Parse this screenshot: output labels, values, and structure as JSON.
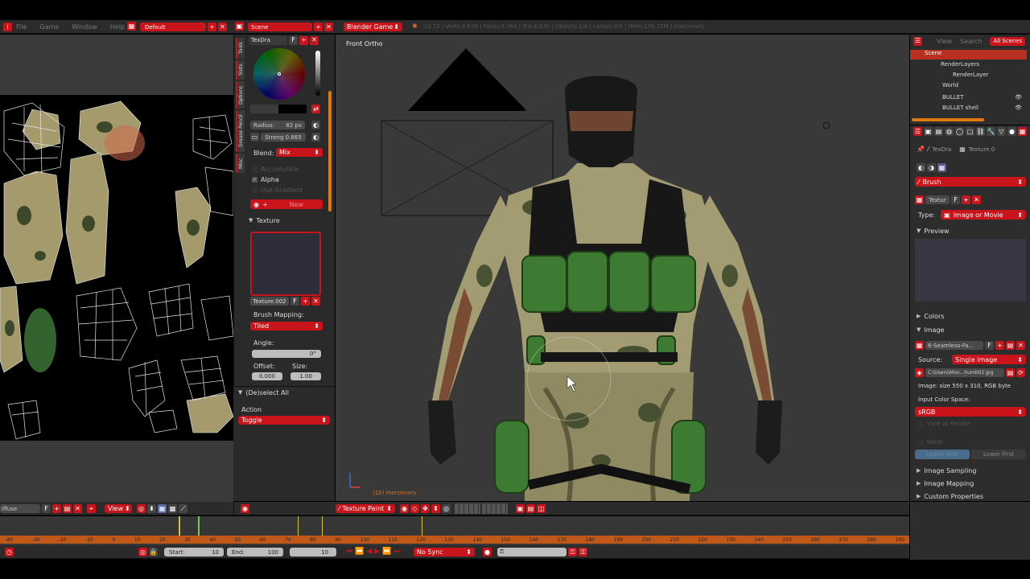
{
  "top": {
    "menus": [
      "File",
      "Game",
      "Window",
      "Help"
    ],
    "layout": "Default",
    "scene": "Scene",
    "engine": "Blender Game",
    "stats": "v2.73 | Verts:3,639 | Faces:3,364 | Tris:6,670 | Objects:1/4 | Lamps:0/2 | Mem:178.25M | mercenary"
  },
  "tool_panel": {
    "tab_name": "TexDra",
    "f_label": "F",
    "vtabs": [
      "Tools",
      "Slots",
      "Options",
      "Grease Pencil",
      "Misc"
    ],
    "radius_label": "Radius:",
    "radius_value": "82 px",
    "strength_label": "Streng",
    "strength_value": "0.665",
    "blend_label": "Blend:",
    "blend_value": "Mix",
    "accumulate": "Accumulate",
    "alpha": "Alpha",
    "use_gradient": "Use Gradient",
    "new_label": "New",
    "texture_header": "Texture",
    "texture_name": "Texture.002",
    "brush_mapping_label": "Brush Mapping:",
    "brush_mapping_value": "Tiled",
    "angle_label": "Angle:",
    "angle_value": "0°",
    "offset_label": "Offset:",
    "size_label": "Size:",
    "offset_value": "0.000",
    "size_value": "1.00"
  },
  "operator": {
    "title": "(De)select All",
    "action_label": "Action",
    "action_value": "Toggle"
  },
  "viewport": {
    "view_name": "Front Ortho",
    "object_label": "(10) mercenary",
    "header_mode": "Texture Paint"
  },
  "uv": {
    "image_name": "iffuse",
    "f_label": "F",
    "view_btn": "View"
  },
  "outliner": {
    "view": "View",
    "search": "Search",
    "scope": "All Scenes",
    "items": [
      "Scene",
      "RenderLayers",
      "RenderLayer",
      "World",
      "BULLET",
      "BULLET shell"
    ]
  },
  "props": {
    "tab_texdra": "TexDra",
    "tab_texture": "Texture.0",
    "brush": "Brush",
    "texture_name": "Textur",
    "f_label": "F",
    "type_label": "Type:",
    "type_value": "Image or Movie",
    "preview": "Preview",
    "colors": "Colors",
    "image": "Image",
    "image_name": "6-Seamless-Fa...",
    "source_label": "Source:",
    "source_value": "Single Image",
    "path": "C:\\Users\\Mon...humb02.jpg",
    "info": "Image: size 550 x 310, RGB byte",
    "colorspace_label": "Input Color Space:",
    "colorspace_value": "sRGB",
    "view_as_render": "View as Render",
    "fields": "Fields",
    "upper_first": "Upper First",
    "lower_first": "Lower First",
    "image_sampling": "Image Sampling",
    "image_mapping": "Image Mapping",
    "custom_props": "Custom Properties"
  },
  "timeline": {
    "ticks": [
      "-40",
      "-30",
      "-20",
      "-10",
      "0",
      "10",
      "20",
      "30",
      "40",
      "50",
      "60",
      "70",
      "80",
      "90",
      "100",
      "110",
      "120",
      "130",
      "140",
      "150",
      "160",
      "170",
      "180",
      "190",
      "200",
      "210",
      "220",
      "230",
      "240",
      "250",
      "260",
      "270",
      "280",
      "290"
    ],
    "start_label": "Start:",
    "start_value": "10",
    "end_label": "End:",
    "end_value": "100",
    "current_frame": "10",
    "sync": "No Sync"
  }
}
